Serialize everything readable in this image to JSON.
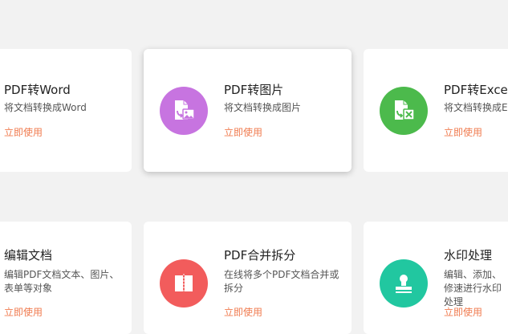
{
  "cards": [
    {
      "title": "PDF转Word",
      "desc": "将文档转换成Word",
      "action": "立即使用"
    },
    {
      "title": "PDF转图片",
      "desc": "将文档转换成图片",
      "action": "立即使用",
      "icon": "pdf-to-image-icon",
      "color": "#c774e0"
    },
    {
      "title": "PDF转Excel",
      "desc": "将文档转换成E",
      "action": "立即使用",
      "icon": "pdf-to-excel-icon",
      "color": "#4cba4c"
    },
    {
      "title": "编辑文档",
      "desc": "编辑PDF文档文本、图片、表单等对象",
      "action": "立即使用"
    },
    {
      "title": "PDF合并拆分",
      "desc": "在线将多个PDF文档合并或拆分",
      "action": "立即使用",
      "icon": "merge-split-icon",
      "color": "#f25c5c"
    },
    {
      "title": "水印处理",
      "desc": "编辑、添加、修速进行水印处理",
      "action": "立即使用",
      "icon": "watermark-stamp-icon",
      "color": "#21c7a0"
    }
  ]
}
